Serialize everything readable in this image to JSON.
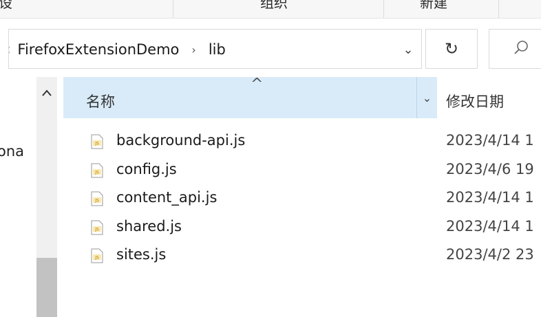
{
  "ribbon": {
    "groups": [
      "设",
      "组织",
      "新建"
    ]
  },
  "address_bar": {
    "leading_chevron": "‹",
    "crumbs": [
      "FirefoxExtensionDemo",
      "lib"
    ],
    "separator": "›",
    "dropdown_glyph": "⌄"
  },
  "toolbar": {
    "refresh_glyph": "↻",
    "search_icon": "search-icon"
  },
  "nav_pane": {
    "clipped_label": "ona"
  },
  "columns": {
    "name": "名称",
    "date_modified": "修改日期",
    "sort_indicator": "^",
    "dropdown_glyph": "⌄"
  },
  "files": [
    {
      "name": "background-api.js",
      "date": "2023/4/14 1",
      "icon": "js-file-icon"
    },
    {
      "name": "config.js",
      "date": "2023/4/6 19",
      "icon": "js-file-icon"
    },
    {
      "name": "content_api.js",
      "date": "2023/4/14 1",
      "icon": "js-file-icon"
    },
    {
      "name": "shared.js",
      "date": "2023/4/14 1",
      "icon": "js-file-icon"
    },
    {
      "name": "sites.js",
      "date": "2023/4/2 23",
      "icon": "js-file-icon"
    }
  ],
  "colors": {
    "header_selected": "#d9ebf9",
    "border": "#d9d9d9",
    "scrollbar_thumb": "#c2c2c2",
    "js_icon_accent": "#e8b21a"
  }
}
